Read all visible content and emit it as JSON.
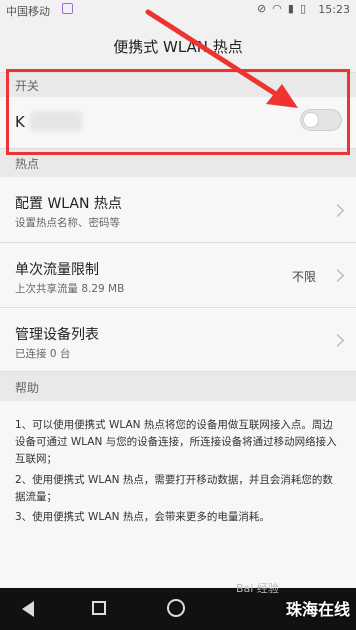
{
  "status_bar": {
    "carrier": "中国移动",
    "time": "15:23",
    "icons": [
      "mute-icon",
      "wifi-icon",
      "signal-icon",
      "battery-icon"
    ]
  },
  "header": {
    "title": "便携式 WLAN 热点"
  },
  "switch_section": {
    "header": "开关",
    "network_name": "K",
    "toggle_state": "off"
  },
  "hotspot_section": {
    "header": "热点",
    "items": [
      {
        "title": "配置 WLAN 热点",
        "subtitle": "设置热点名称、密码等",
        "value": ""
      },
      {
        "title": "单次流量限制",
        "subtitle": "上次共享流量 8.29 MB",
        "value": "不限"
      },
      {
        "title": "管理设备列表",
        "subtitle": "已连接 0 台",
        "value": ""
      }
    ]
  },
  "help_section": {
    "header": "帮助",
    "paragraphs": [
      "1、可以使用便携式 WLAN 热点将您的设备用做互联网接入点。周边设备可通过 WLAN 与您的设备连接，所连接设备将通过移动网络接入互联网；",
      "2、使用便携式 WLAN 热点，需要打开移动数据，并且会消耗您的数据流量；",
      "3、使用便携式 WLAN 热点，会带来更多的电量消耗。"
    ]
  },
  "watermark": {
    "text": "珠海在线",
    "baidu_text": "Bai 经验"
  },
  "annotation": {
    "color": "#e53935"
  }
}
